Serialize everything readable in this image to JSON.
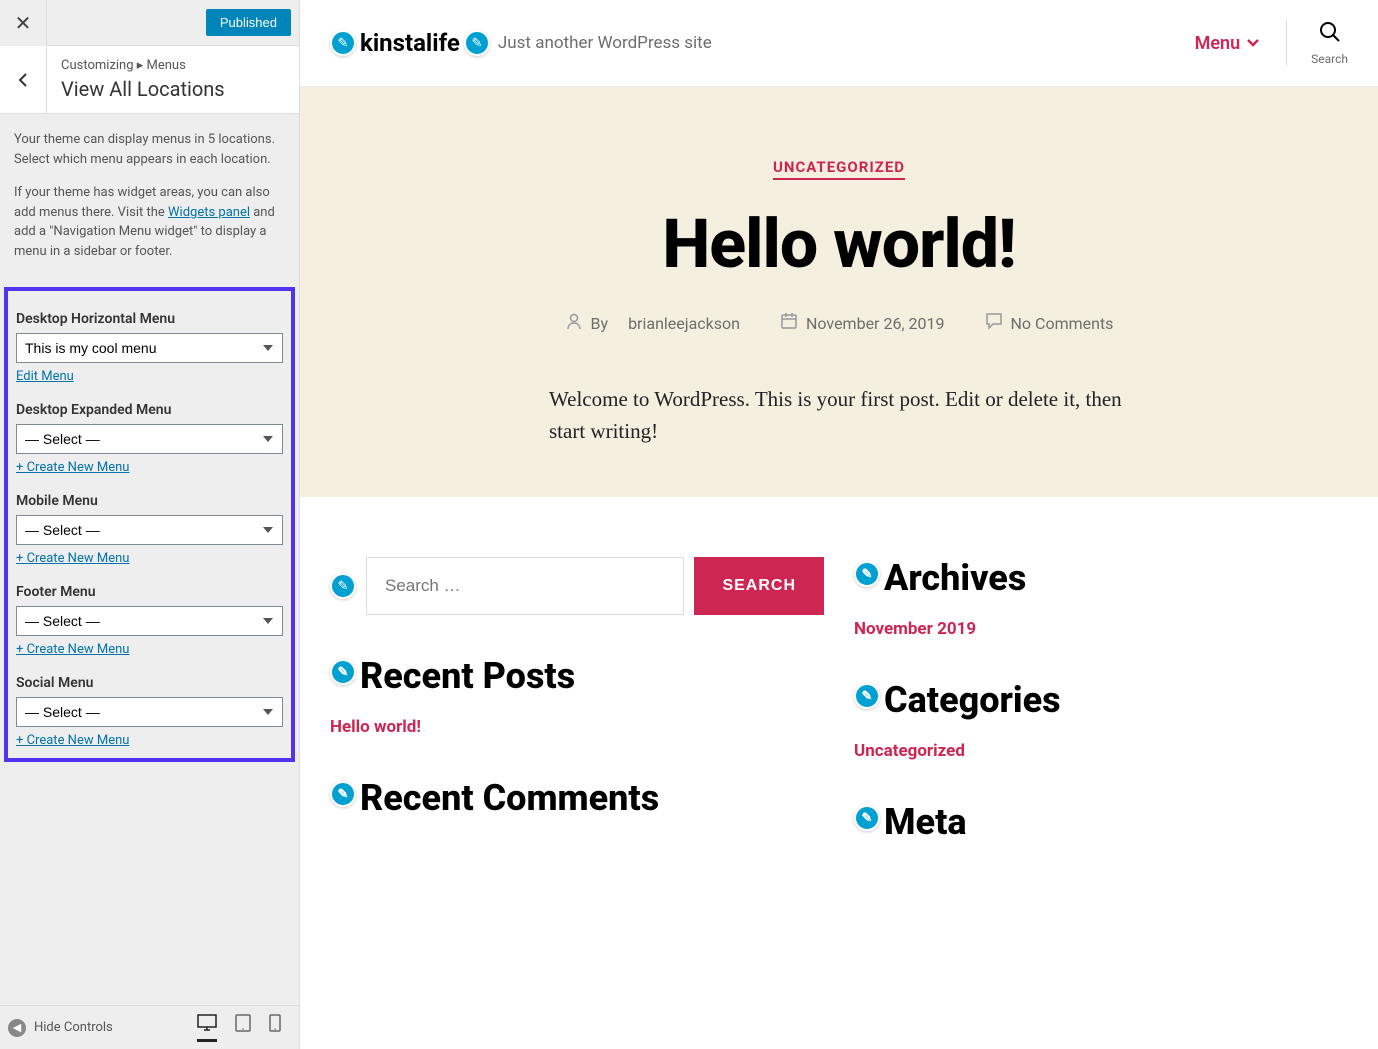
{
  "sidebar": {
    "published_btn": "Published",
    "breadcrumb": "Customizing ▸ Menus",
    "title": "View All Locations",
    "desc1": "Your theme can display menus in 5 locations. Select which menu appears in each location.",
    "desc2a": "If your theme has widget areas, you can also add menus there. Visit the ",
    "widgets_link": "Widgets panel",
    "desc2b": " and add a \"Navigation Menu widget\" to display a menu in a sidebar or footer.",
    "locations": [
      {
        "label": "Desktop Horizontal Menu",
        "value": "This is my cool menu",
        "link": "Edit Menu"
      },
      {
        "label": "Desktop Expanded Menu",
        "value": "— Select —",
        "link": "+ Create New Menu"
      },
      {
        "label": "Mobile Menu",
        "value": "— Select —",
        "link": "+ Create New Menu"
      },
      {
        "label": "Footer Menu",
        "value": "— Select —",
        "link": "+ Create New Menu"
      },
      {
        "label": "Social Menu",
        "value": "— Select —",
        "link": "+ Create New Menu"
      }
    ],
    "hide_controls": "Hide Controls"
  },
  "preview": {
    "site_title": "kinstalife",
    "site_tagline": "Just another WordPress site",
    "menu_label": "Menu",
    "search_label": "Search",
    "category": "UNCATEGORIZED",
    "post_title": "Hello world!",
    "meta_by": "By",
    "meta_author": "brianleejackson",
    "meta_date": "November 26, 2019",
    "meta_comments": "No Comments",
    "excerpt": "Welcome to WordPress. This is your first post. Edit or delete it, then start writing!",
    "search_placeholder": "Search …",
    "search_btn": "SEARCH",
    "widget_recent_posts": "Recent Posts",
    "recent_post_link": "Hello world!",
    "widget_recent_comments": "Recent Comments",
    "widget_archives": "Archives",
    "archive_link": "November 2019",
    "widget_categories": "Categories",
    "category_link": "Uncategorized",
    "widget_meta": "Meta"
  }
}
